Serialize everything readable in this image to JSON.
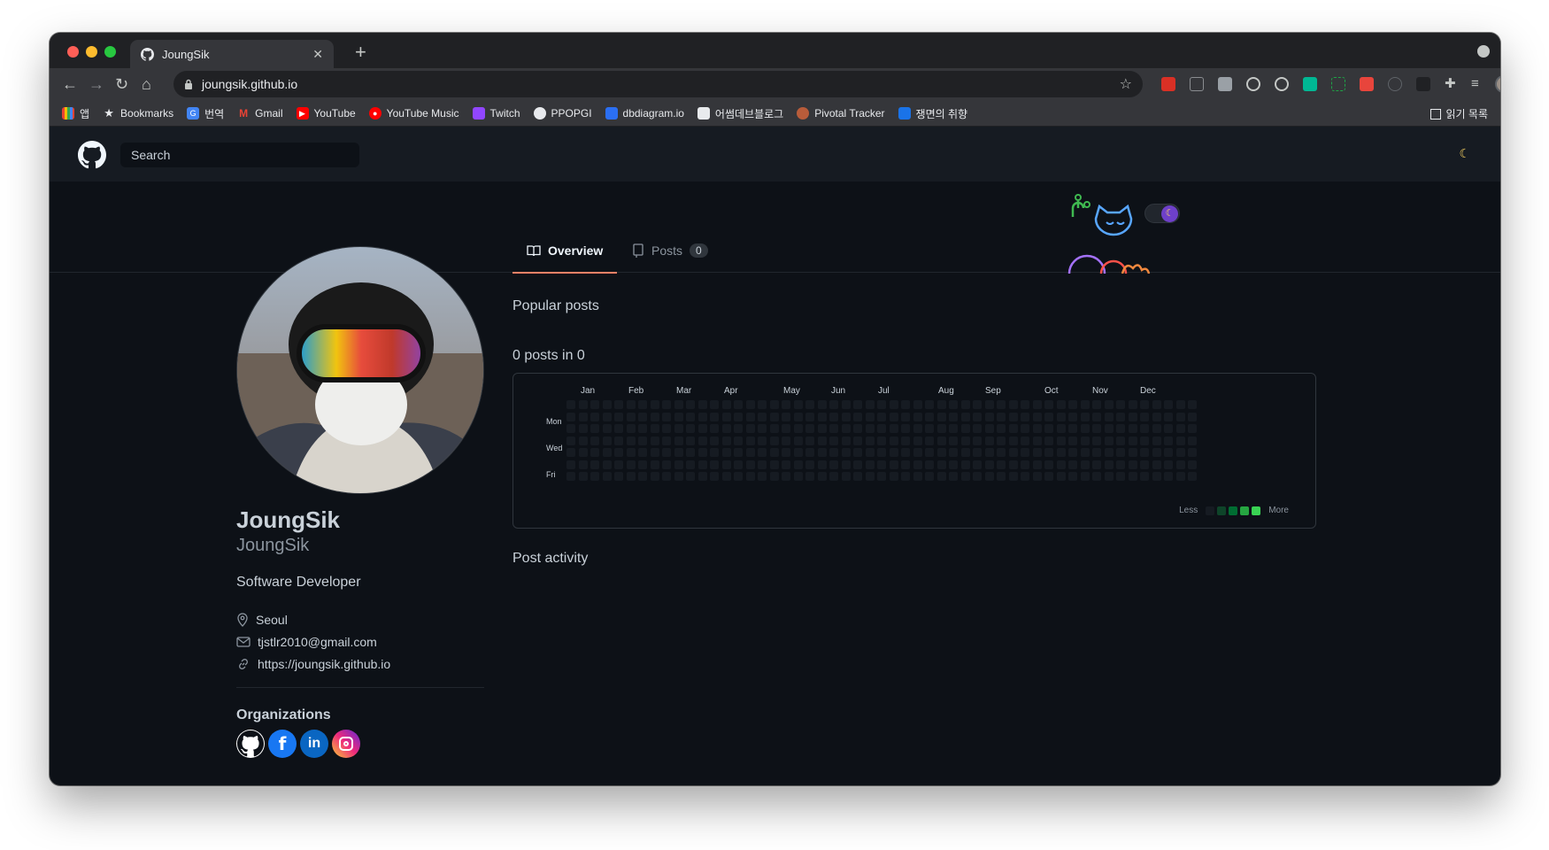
{
  "browser": {
    "tab_title": "JoungSik",
    "url": "joungsik.github.io",
    "bookmarks": [
      "앱",
      "Bookmarks",
      "번역",
      "Gmail",
      "YouTube",
      "YouTube Music",
      "Twitch",
      "PPOPGI",
      "dbdiagram.io",
      "어썸데브블로그",
      "Pivotal Tracker",
      "쟁면의 취향"
    ],
    "reading_list": "읽기 목록"
  },
  "header": {
    "search_label": "Search"
  },
  "tabs": {
    "overview": "Overview",
    "posts": "Posts",
    "posts_count": "0"
  },
  "profile": {
    "name": "JoungSik",
    "login": "JoungSik",
    "bio": "Software Developer",
    "location": "Seoul",
    "email": "tjstlr2010@gmail.com",
    "website": "https://joungsik.github.io",
    "orgs_title": "Organizations"
  },
  "main": {
    "popular_title": "Popular posts",
    "contrib_title": "0 posts in 0",
    "activity_title": "Post activity"
  },
  "calendar": {
    "months": [
      "Jan",
      "Feb",
      "Mar",
      "Apr",
      "May",
      "Jun",
      "Jul",
      "Aug",
      "Sep",
      "Oct",
      "Nov",
      "Dec"
    ],
    "days": [
      "Mon",
      "Wed",
      "Fri"
    ],
    "legend_less": "Less",
    "legend_more": "More",
    "empty_color": "#161b22",
    "legend_colors": [
      "#161b22",
      "#0e4429",
      "#006d32",
      "#26a641",
      "#39d353"
    ]
  },
  "colors": {
    "accent_tab": "#f78166",
    "page_bg": "#0d1117",
    "header_bg": "#161b22"
  }
}
